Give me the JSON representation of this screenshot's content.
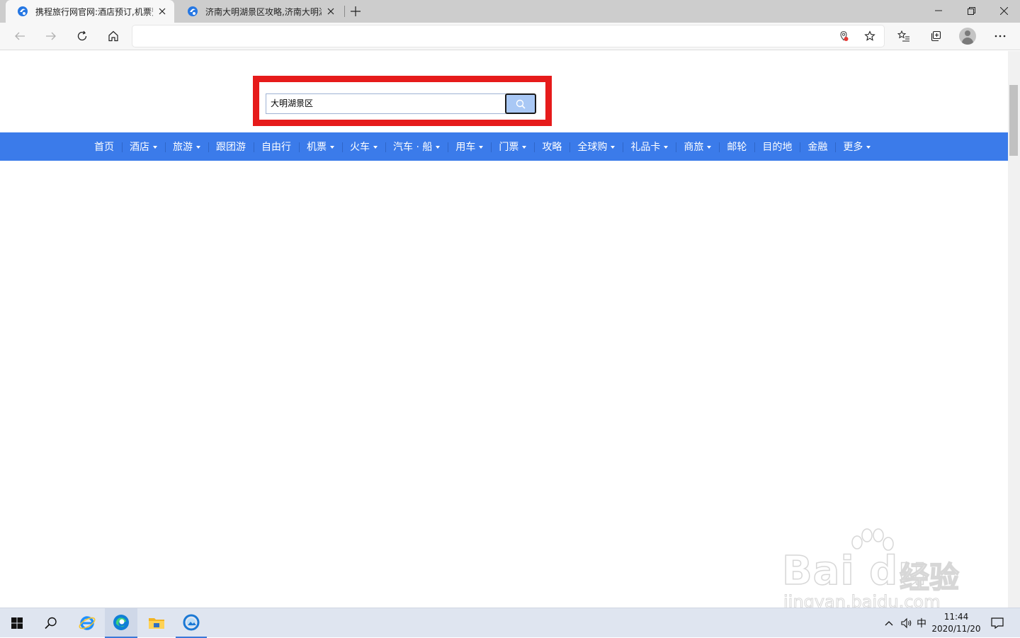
{
  "browser": {
    "tabs": [
      {
        "title": "携程旅行网官网:酒店预订,机票预",
        "active": true
      },
      {
        "title": "济南大明湖景区攻略,济南大明湖",
        "active": false
      }
    ],
    "address": "",
    "accent": "#3b7bea"
  },
  "page": {
    "search": {
      "value": "大明湖景区",
      "button_icon": "search-icon"
    },
    "highlight_color": "#e61b1b",
    "nav": [
      {
        "label": "首页",
        "dropdown": false
      },
      {
        "label": "酒店",
        "dropdown": true
      },
      {
        "label": "旅游",
        "dropdown": true
      },
      {
        "label": "跟团游",
        "dropdown": false
      },
      {
        "label": "自由行",
        "dropdown": false
      },
      {
        "label": "机票",
        "dropdown": true
      },
      {
        "label": "火车",
        "dropdown": true
      },
      {
        "label": "汽车 · 船",
        "dropdown": true
      },
      {
        "label": "用车",
        "dropdown": true
      },
      {
        "label": "门票",
        "dropdown": true
      },
      {
        "label": "攻略",
        "dropdown": false
      },
      {
        "label": "全球购",
        "dropdown": true
      },
      {
        "label": "礼品卡",
        "dropdown": true
      },
      {
        "label": "商旅",
        "dropdown": true
      },
      {
        "label": "邮轮",
        "dropdown": false
      },
      {
        "label": "目的地",
        "dropdown": false
      },
      {
        "label": "金融",
        "dropdown": false
      },
      {
        "label": "更多",
        "dropdown": true
      }
    ]
  },
  "watermark": {
    "brand": "Bai du",
    "cn": "经验",
    "url": "jingyan.baidu.com"
  },
  "taskbar": {
    "ime": "中",
    "time": "11:44",
    "date": "2020/11/20"
  }
}
